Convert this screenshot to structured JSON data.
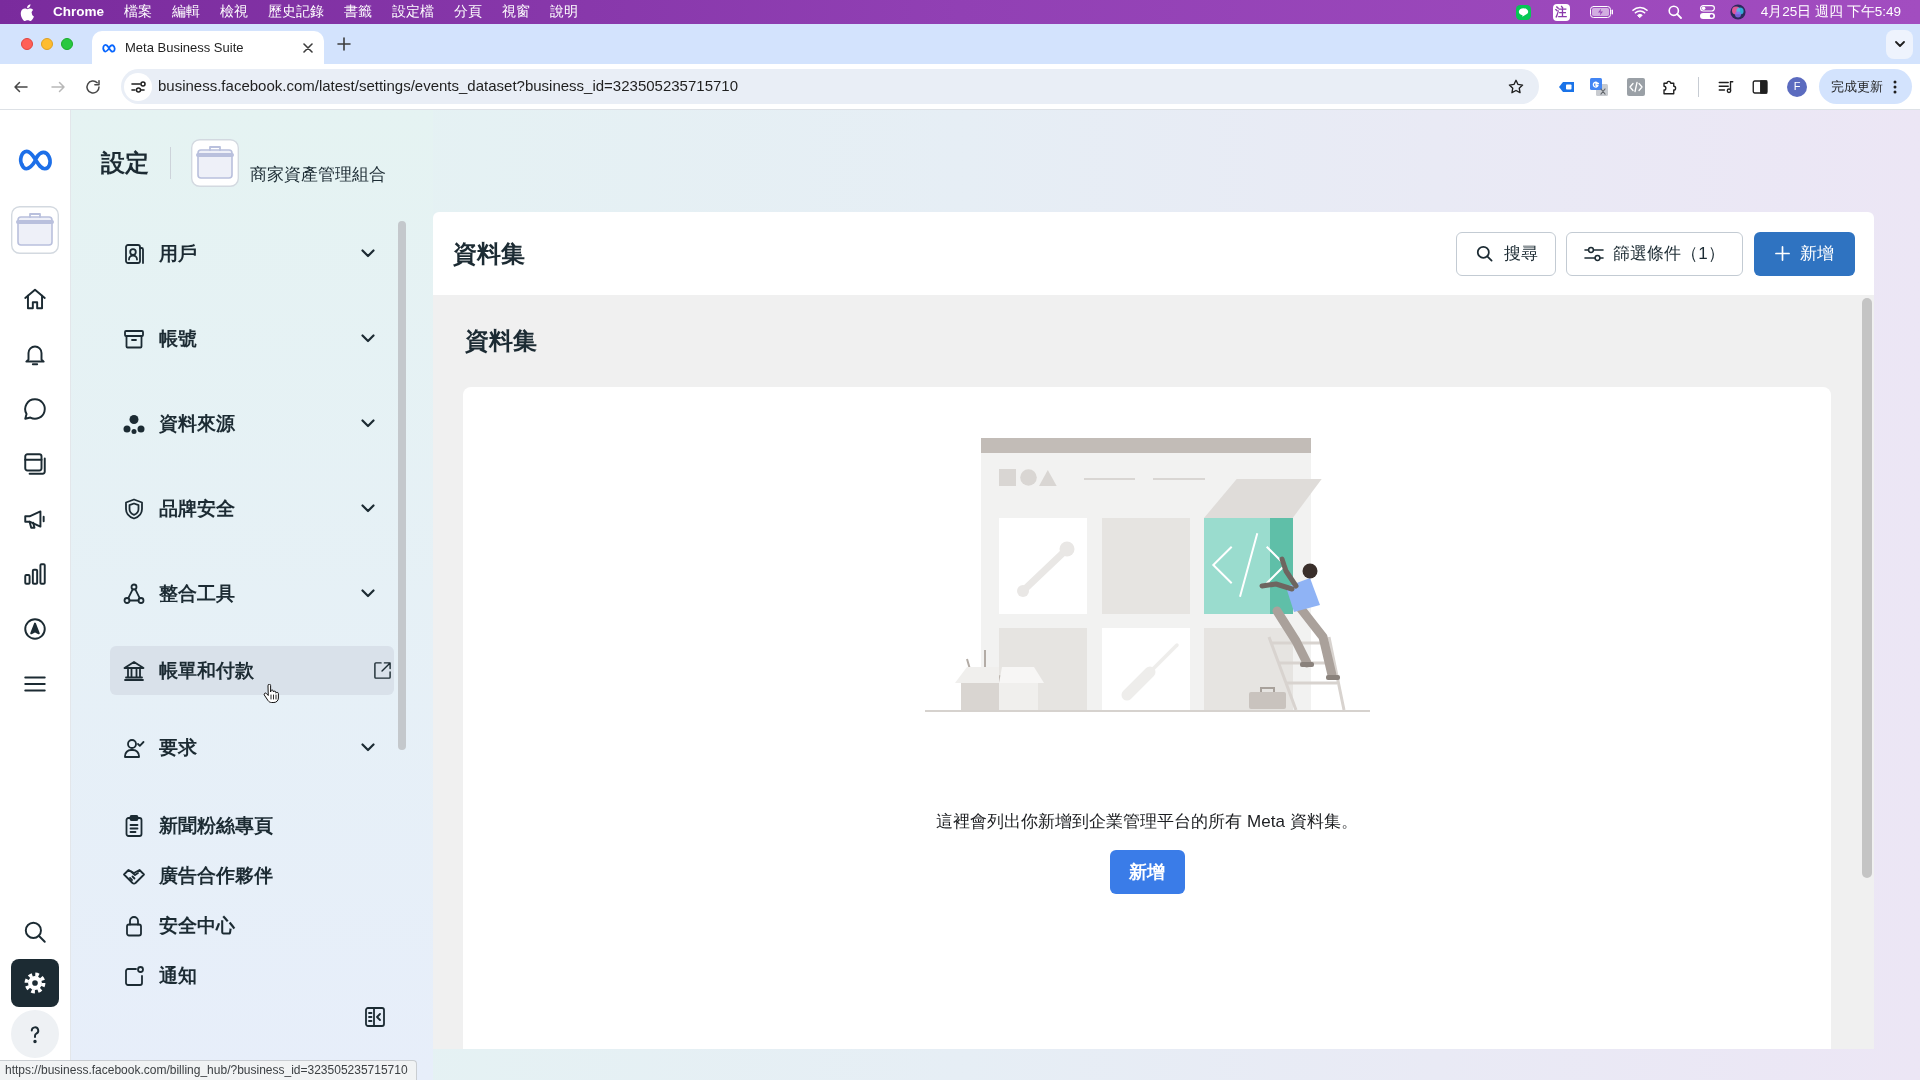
{
  "menu_bar": {
    "app": "Chrome",
    "menus": [
      "檔案",
      "編輯",
      "檢視",
      "歷史記錄",
      "書籤",
      "設定檔",
      "分頁",
      "視窗",
      "說明"
    ],
    "input_method": "注",
    "clock": "4月25日 週四 下午5:49"
  },
  "browser": {
    "tabs": [
      {
        "title": "Meta Business Suite",
        "selected": true
      }
    ],
    "url": "business.facebook.com/latest/settings/events_dataset?business_id=323505235715710",
    "profile_initial": "F",
    "update_button": "完成更新"
  },
  "rail": {
    "top_items": [
      {
        "selected": false
      },
      {
        "selected": false
      },
      {
        "selected": false
      },
      {
        "selected": false
      },
      {
        "selected": false
      },
      {
        "selected": false
      },
      {
        "selected": false
      },
      {
        "selected": false
      }
    ],
    "bottom_items": [
      {
        "selected": false
      },
      {
        "selected": true
      },
      {
        "selected": false
      }
    ]
  },
  "settings_sidebar": {
    "title": "設定",
    "business_name": "商家資產管理組合",
    "items": [
      {
        "label": "用戶",
        "kind": "group",
        "expanded": false,
        "hovered": false
      },
      {
        "label": "帳號",
        "kind": "group",
        "expanded": false,
        "hovered": false
      },
      {
        "label": "資料來源",
        "kind": "group",
        "expanded": false,
        "hovered": false
      },
      {
        "label": "品牌安全",
        "kind": "group",
        "expanded": false,
        "hovered": false
      },
      {
        "label": "整合工具",
        "kind": "group",
        "expanded": false,
        "hovered": false
      },
      {
        "label": "帳單和付款",
        "kind": "external",
        "hovered": true
      },
      {
        "label": "要求",
        "kind": "group",
        "expanded": false,
        "hovered": false
      },
      {
        "label": "新聞粉絲專頁",
        "kind": "page",
        "hovered": false
      },
      {
        "label": "廣告合作夥伴",
        "kind": "page",
        "hovered": false
      },
      {
        "label": "安全中心",
        "kind": "page",
        "hovered": false
      },
      {
        "label": "通知",
        "kind": "page",
        "hovered": false
      }
    ]
  },
  "dataset_page": {
    "header_title": "資料集",
    "search_button": "搜尋",
    "filter_button": "篩選條件（1）",
    "new_button": "新增",
    "section_title": "資料集",
    "empty_message": "這裡會列出你新增到企業管理平台的所有 Meta 資料集。",
    "empty_add_button": "新增"
  },
  "status_bar": {
    "url": "https://business.facebook.com/billing_hub/?business_id=323505235715710"
  }
}
